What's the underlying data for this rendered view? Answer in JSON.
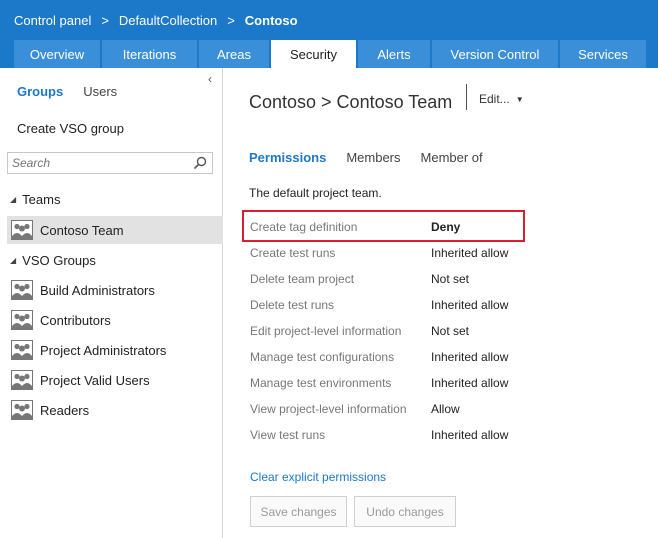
{
  "breadcrumb": {
    "items": [
      "Control panel",
      "DefaultCollection",
      "Contoso"
    ],
    "separator": ">"
  },
  "tabs": [
    {
      "label": "Overview"
    },
    {
      "label": "Iterations"
    },
    {
      "label": "Areas"
    },
    {
      "label": "Security",
      "active": true
    },
    {
      "label": "Alerts"
    },
    {
      "label": "Version Control"
    },
    {
      "label": "Services"
    }
  ],
  "left_panel": {
    "collapse_glyph": "‹",
    "groups_tab": "Groups",
    "users_tab": "Users",
    "create_group": "Create VSO group",
    "search_placeholder": "Search",
    "teams_header": "Teams",
    "teams": [
      "Contoso Team"
    ],
    "vso_header": "VSO Groups",
    "vso_groups": [
      "Build Administrators",
      "Contributors",
      "Project Administrators",
      "Project Valid Users",
      "Readers"
    ]
  },
  "main": {
    "title": "Contoso > Contoso Team",
    "edit_label": "Edit...",
    "subtabs": [
      "Permissions",
      "Members",
      "Member of"
    ],
    "description": "The default project team.",
    "permissions": [
      {
        "name": "Create tag definition",
        "value": "Deny"
      },
      {
        "name": "Create test runs",
        "value": "Inherited allow"
      },
      {
        "name": "Delete team project",
        "value": "Not set"
      },
      {
        "name": "Delete test runs",
        "value": "Inherited allow"
      },
      {
        "name": "Edit project-level information",
        "value": "Not set"
      },
      {
        "name": "Manage test configurations",
        "value": "Inherited allow"
      },
      {
        "name": "Manage test environments",
        "value": "Inherited allow"
      },
      {
        "name": "View project-level information",
        "value": "Allow"
      },
      {
        "name": "View test runs",
        "value": "Inherited allow"
      }
    ],
    "clear_link": "Clear explicit permissions",
    "save_button": "Save changes",
    "undo_button": "Undo changes"
  },
  "colors": {
    "header_bg": "#1c78c8",
    "tab_bg": "#3b8fd8",
    "link": "#1c78c8",
    "highlight_border": "#d8202c"
  }
}
